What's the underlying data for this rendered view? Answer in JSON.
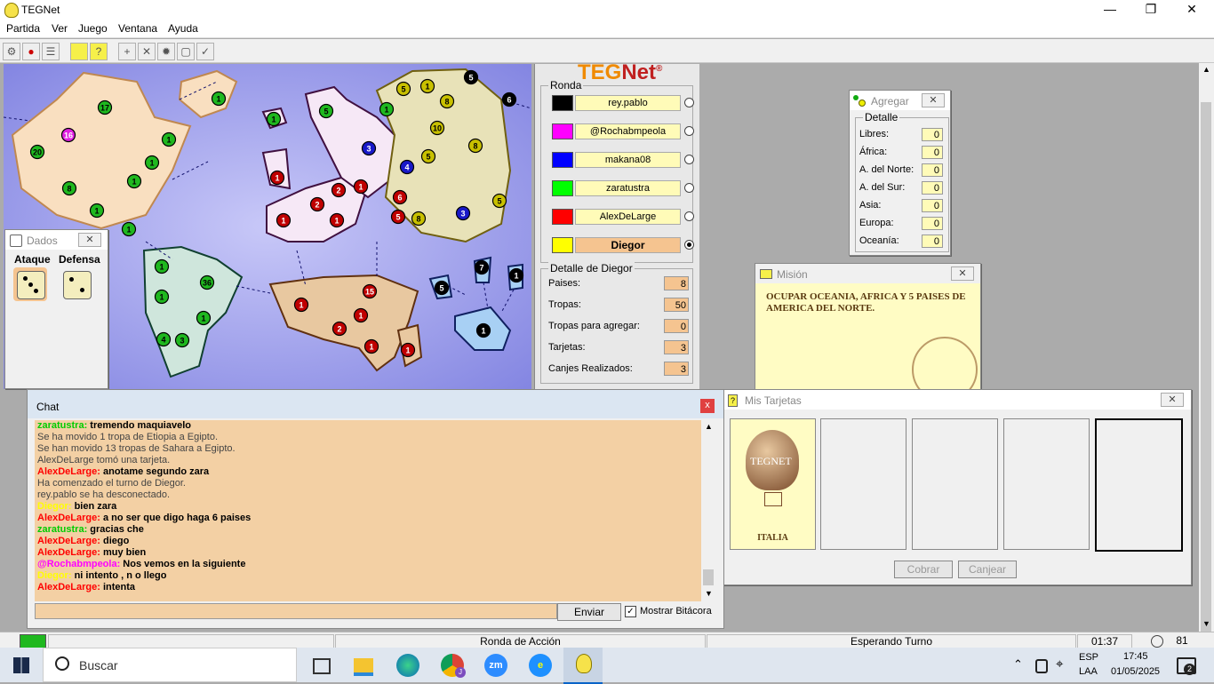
{
  "window": {
    "title": "TEGNet"
  },
  "menu": [
    "Partida",
    "Ver",
    "Juego",
    "Ventana",
    "Ayuda"
  ],
  "map": {
    "countries": [
      {
        "n": "17",
        "c": "#1fb81f"
      },
      {
        "n": "1",
        "c": "#1fb81f"
      },
      {
        "n": "1",
        "c": "#1fb81f"
      },
      {
        "n": "16",
        "c": "#e020e0"
      },
      {
        "n": "20",
        "c": "#1fb81f"
      },
      {
        "n": "1",
        "c": "#1fb81f"
      },
      {
        "n": "8",
        "c": "#1fb81f"
      },
      {
        "n": "1",
        "c": "#1fb81f"
      },
      {
        "n": "1",
        "c": "#1fb81f"
      },
      {
        "n": "1",
        "c": "#1fb81f"
      },
      {
        "n": "1",
        "c": "#1fb81f"
      },
      {
        "n": "5",
        "c": "#1fb81f"
      },
      {
        "n": "3",
        "c": "#1818c8"
      },
      {
        "n": "4",
        "c": "#1818c8"
      },
      {
        "n": "3",
        "c": "#1818c8"
      },
      {
        "n": "1",
        "c": "#c00000"
      },
      {
        "n": "1",
        "c": "#c00000"
      },
      {
        "n": "2",
        "c": "#c00000"
      },
      {
        "n": "2",
        "c": "#c00000"
      },
      {
        "n": "1",
        "c": "#c00000"
      },
      {
        "n": "1",
        "c": "#c00000"
      },
      {
        "n": "6",
        "c": "#c00000"
      },
      {
        "n": "5",
        "c": "#c00000"
      },
      {
        "n": "8",
        "c": "#c8c000"
      },
      {
        "n": "5",
        "c": "#c8c000"
      },
      {
        "n": "1",
        "c": "#c8c000"
      },
      {
        "n": "8",
        "c": "#c8c000"
      },
      {
        "n": "10",
        "c": "#c8c000"
      },
      {
        "n": "5",
        "c": "#c8c000"
      },
      {
        "n": "8",
        "c": "#c8c000"
      },
      {
        "n": "5",
        "c": "#c8c000"
      },
      {
        "n": "1",
        "c": "#1fb81f"
      },
      {
        "n": "5",
        "c": "#000000"
      },
      {
        "n": "6",
        "c": "#000000"
      },
      {
        "n": "7",
        "c": "#000000"
      },
      {
        "n": "1",
        "c": "#000000"
      },
      {
        "n": "5",
        "c": "#000000"
      },
      {
        "n": "1",
        "c": "#000000"
      },
      {
        "n": "1",
        "c": "#1fb81f"
      },
      {
        "n": "36",
        "c": "#1fb81f"
      },
      {
        "n": "1",
        "c": "#1fb81f"
      },
      {
        "n": "1",
        "c": "#1fb81f"
      },
      {
        "n": "4",
        "c": "#1fb81f"
      },
      {
        "n": "3",
        "c": "#1fb81f"
      },
      {
        "n": "15",
        "c": "#c00000"
      },
      {
        "n": "1",
        "c": "#c00000"
      },
      {
        "n": "1",
        "c": "#c00000"
      },
      {
        "n": "2",
        "c": "#c00000"
      },
      {
        "n": "1",
        "c": "#c00000"
      },
      {
        "n": "1",
        "c": "#c00000"
      }
    ]
  },
  "logo": {
    "teg": "TEG",
    "net": "Net",
    "reg": "®"
  },
  "ronda": {
    "title": "Ronda",
    "players": [
      {
        "name": "rey.pablo",
        "color": "#000000",
        "selected": false
      },
      {
        "name": "@Rochabmpeola",
        "color": "#ff00ff",
        "selected": false
      },
      {
        "name": "makana08",
        "color": "#0000ff",
        "selected": false
      },
      {
        "name": "zaratustra",
        "color": "#00ff00",
        "selected": false
      },
      {
        "name": "AlexDeLarge",
        "color": "#ff0000",
        "selected": false
      },
      {
        "name": "Diegor",
        "color": "#ffff00",
        "selected": true
      }
    ]
  },
  "detalle": {
    "title": "Detalle de Diegor",
    "rows": [
      {
        "label": "Paises:",
        "value": "8"
      },
      {
        "label": "Tropas:",
        "value": "50"
      },
      {
        "label": "Tropas para agregar:",
        "value": "0"
      },
      {
        "label": "Tarjetas:",
        "value": "3"
      },
      {
        "label": "Canjes Realizados:",
        "value": "3"
      }
    ]
  },
  "agregar": {
    "title": "Agregar",
    "group": "Detalle",
    "rows": [
      {
        "label": "Libres:",
        "value": "0"
      },
      {
        "label": "África:",
        "value": "0"
      },
      {
        "label": "A. del Norte:",
        "value": "0"
      },
      {
        "label": "A. del Sur:",
        "value": "0"
      },
      {
        "label": "Asia:",
        "value": "0"
      },
      {
        "label": "Europa:",
        "value": "0"
      },
      {
        "label": "Oceanía:",
        "value": "0"
      }
    ]
  },
  "dados": {
    "title": "Dados",
    "ataque": "Ataque",
    "defensa": "Defensa"
  },
  "mision": {
    "title": "Misión",
    "text": "OCUPAR OCEANIA, AFRICA Y 5 PAISES DE AMERICA DEL NORTE."
  },
  "tarjetas": {
    "title": "Mis Tarjetas",
    "card1_logo": "TEGNET",
    "card1_country": "ITALIA",
    "cobrar": "Cobrar",
    "canjear": "Canjear"
  },
  "chat": {
    "title": "Chat",
    "close": "x",
    "send": "Enviar",
    "mostrar": "Mostrar Bitácora",
    "lines": [
      {
        "user": "zaratustra:",
        "ucolor": "#00cc00",
        "msg": "tremendo maquiavelo"
      },
      {
        "user": "",
        "ucolor": "",
        "msg": "Se ha movido 1 tropa de Etiopia a Egipto."
      },
      {
        "user": "",
        "ucolor": "",
        "msg": "Se han movido 13 tropas de Sahara a Egipto."
      },
      {
        "user": "",
        "ucolor": "",
        "msg": "AlexDeLarge tomó una tarjeta."
      },
      {
        "user": "AlexDeLarge:",
        "ucolor": "#ff0000",
        "msg": "anotame segundo zara"
      },
      {
        "user": "",
        "ucolor": "",
        "msg": "Ha comenzado el turno de Diegor."
      },
      {
        "user": "",
        "ucolor": "",
        "msg": "rey.pablo se ha desconectado."
      },
      {
        "user": "Diegor:",
        "ucolor": "#ffff00",
        "msg": "bien zara"
      },
      {
        "user": "AlexDeLarge:",
        "ucolor": "#ff0000",
        "msg": "a no ser que digo haga 6 paises"
      },
      {
        "user": "zaratustra:",
        "ucolor": "#00cc00",
        "msg": "gracias che"
      },
      {
        "user": "AlexDeLarge:",
        "ucolor": "#ff0000",
        "msg": "diego"
      },
      {
        "user": "AlexDeLarge:",
        "ucolor": "#ff0000",
        "msg": "muy bien"
      },
      {
        "user": "@Rochabmpeola:",
        "ucolor": "#ff00ff",
        "msg": "Nos vemos en la siguiente"
      },
      {
        "user": "Diegor:",
        "ucolor": "#ffff00",
        "msg": "ni intento , n o llego"
      },
      {
        "user": "AlexDeLarge:",
        "ucolor": "#ff0000",
        "msg": "intenta"
      }
    ]
  },
  "status": {
    "round": "Ronda de Acción",
    "turn": "Esperando Turno",
    "time": "01:37",
    "count": "81"
  },
  "taskbar": {
    "search": "Buscar",
    "lang1": "ESP",
    "lang2": "LAA",
    "clock": "17:45",
    "date": "01/05/2025",
    "notif": "2",
    "chrome_badge": "J",
    "zoom": "zm"
  }
}
